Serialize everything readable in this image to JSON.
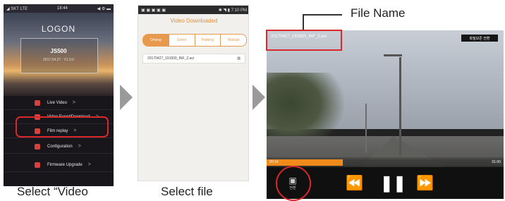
{
  "phone1": {
    "status_left": "◢ SKT  LTE",
    "status_time": "18:44",
    "status_right": "◀ ⚙ ▬",
    "logo": "LOGON",
    "model": "JS500",
    "device_info": "2017.04.27  ·  V1.0.0",
    "menu": [
      {
        "label": "Live Video",
        "icon": "live-video-icon"
      },
      {
        "label": "Video Event/Download",
        "icon": "download-icon"
      },
      {
        "label": "Film replay",
        "icon": "film-replay-icon"
      },
      {
        "label": "Configuration",
        "icon": "gear-icon"
      },
      {
        "label": "Firmware Upgrade",
        "icon": "upgrade-icon"
      }
    ],
    "chevron": ">",
    "caption": "Select “Video"
  },
  "phone2": {
    "status_left": "▣ ▣ ▣ ▣ ▣",
    "status_right": "✱ ◥ ▮ 7:10 PM",
    "title": "Video Downloaded",
    "tabs": [
      {
        "label": "Driving",
        "active": true
      },
      {
        "label": "Event",
        "active": false
      },
      {
        "label": "Parking",
        "active": false
      },
      {
        "label": "Manual",
        "active": false
      }
    ],
    "file_name": "20170427_191830_INF_2.avi",
    "file_action": "▥",
    "caption": "Select file"
  },
  "video": {
    "file_name": "20170427_191830_INF_2.avi",
    "top_right_tag": "화질보존 전환",
    "time_current": "00:14",
    "time_total": "01:00",
    "progress": 0.32,
    "save_label": "전환",
    "rewind_icon": "⏪",
    "play_icon": "❚❚",
    "forward_icon": "⏩"
  },
  "annotation": {
    "file_name_label": "File Name"
  },
  "colors": {
    "highlight": "#d8282c",
    "accent_orange": "#e79a4d",
    "progress": "#f08a1a"
  }
}
